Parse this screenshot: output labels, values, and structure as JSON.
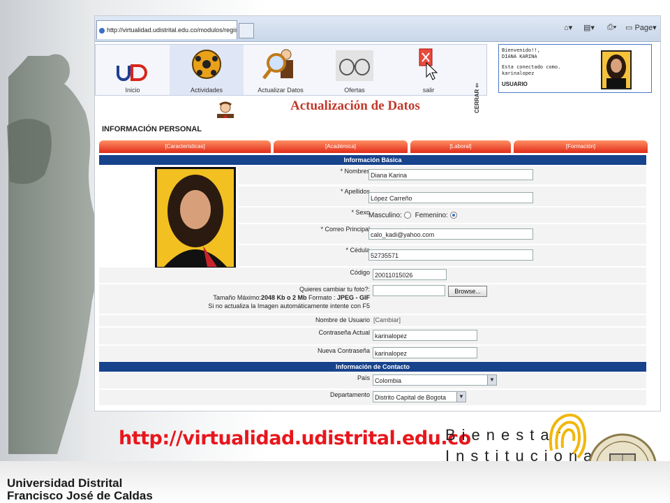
{
  "browser": {
    "tab_title": "http://virtualidad.udistrital.edu.co/modulos/registro/a...",
    "toolbar": {
      "page_label": "Page"
    }
  },
  "nav": {
    "items": [
      {
        "label": "Inicio",
        "icon": "logo-ud-icon"
      },
      {
        "label": "Actividades",
        "icon": "ball-icon"
      },
      {
        "label": "Actualizar Datos",
        "icon": "magnifier-person-icon"
      },
      {
        "label": "Ofertas",
        "icon": "glasses-icon"
      },
      {
        "label": "salir",
        "icon": "exit-icon"
      }
    ],
    "cerrar_label": "CERRAR"
  },
  "welcome": {
    "line1": "Bienvenido!!,",
    "line2": "DIANA KARINA",
    "line3": "Esta conectado como.",
    "line4": "karinalopez",
    "line5": "USUARIO"
  },
  "page": {
    "title": "Actualización de Datos",
    "section_title": "INFORMACIÓN PERSONAL",
    "tabs": [
      "[Caracteristicas]",
      "[Académica]",
      "[Laboral]",
      "[Formación]"
    ],
    "band_basic": "Información Básica",
    "band_contact": "Información de Contacto"
  },
  "form": {
    "nombres_label": "* Nombres",
    "nombres_value": "Diana Karina",
    "apellidos_label": "* Apellidos",
    "apellidos_value": "López Carreño",
    "sexo_label": "* Sexo",
    "masculino_label": "Masculino:",
    "femenino_label": "Femenino:",
    "sexo_selected": "Femenino",
    "correo_label": "* Correo Principal",
    "correo_value": "calo_kadi@yahoo.com",
    "cedula_label": "* Cédula",
    "cedula_value": "52735571",
    "codigo_label": "Código",
    "codigo_value": "20011015026",
    "foto_line1": "Quieres cambiar tu foto?:",
    "foto_line2_prefix": "Tamaño Máximo:",
    "foto_line2_size": "2048 Kb o 2 Mb",
    "foto_line2_format": " Formato : ",
    "foto_line2_types": "JPEG - GIF",
    "foto_line3": "Si no actualiza la Imagen automáticamente intente con F5",
    "browse_label": "Browse...",
    "usuario_label": "Nombre de Usuario",
    "cambiar_label": "[Cambiar]",
    "pass_actual_label": "Contraseña Actual",
    "pass_actual_value": "karinalopez",
    "pass_nueva_label": "Nueva Contraseña",
    "pass_nueva_value": "karinalopez",
    "pais_label": "País",
    "pais_value": "Colombia",
    "depto_label": "Departamento",
    "depto_value": "Distrito Capital de Bogota"
  },
  "footer": {
    "url": "http://virtualidad.udistrital.edu.co",
    "bienestar_line1": "Bienestar",
    "bienestar_line2": "Institucional",
    "university_line1": "Universidad Distrital",
    "university_line2": "Francisco José de Caldas"
  },
  "colors": {
    "accent_red": "#e8161c",
    "band_blue": "#17438c",
    "tab_orange": "#e0200e"
  }
}
